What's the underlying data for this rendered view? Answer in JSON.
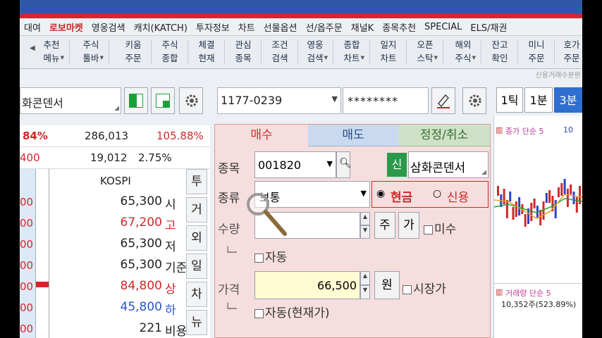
{
  "menu": [
    "대여",
    "로보마켓",
    "영웅검색",
    "캐치(KATCH)",
    "투자정보",
    "차트",
    "선물옵션",
    "선/옵주문",
    "채널K",
    "종목추천",
    "SPECIAL",
    "ELS/채권"
  ],
  "toolbar": [
    {
      "l1": "추천",
      "l2": "메뉴",
      "down": true
    },
    {
      "l1": "주식",
      "l2": "툴바",
      "down": true
    },
    {
      "l1": "키움",
      "l2": "주문",
      "down": false
    },
    {
      "l1": "주식",
      "l2": "종합",
      "down": false
    },
    {
      "l1": "체결",
      "l2": "현재",
      "down": false
    },
    {
      "l1": "관심",
      "l2": "종목",
      "down": false
    },
    {
      "l1": "조건",
      "l2": "검색",
      "down": false
    },
    {
      "l1": "영웅",
      "l2": "검색",
      "down": true
    },
    {
      "l1": "종합",
      "l2": "차트",
      "down": true
    },
    {
      "l1": "일지",
      "l2": "차트",
      "down": false
    },
    {
      "l1": "오픈",
      "l2": "스탁",
      "down": true
    },
    {
      "l1": "해외",
      "l2": "주식",
      "down": true
    },
    {
      "l1": "잔고",
      "l2": "확인",
      "down": false
    },
    {
      "l1": "미니",
      "l2": "주문",
      "down": false
    },
    {
      "l1": "호가",
      "l2": "주문",
      "down": false
    }
  ],
  "status_right": "신용거래수분판",
  "stock_name_box": "화콘덴서",
  "account_number": "1177-0239",
  "password_mask": "********",
  "tick_buttons": [
    "1틱",
    "1분",
    "3분"
  ],
  "left": {
    "rate": "84%",
    "volume": "286,013",
    "pct": "105.88%",
    "left_small": "400",
    "amount": "19,012",
    "amount_pct": "2.75%",
    "index": "KOSPI",
    "price_rows": [
      {
        "side": "00",
        "value": "65,300",
        "label": "시",
        "color": "#222"
      },
      {
        "side": "00",
        "value": "67,200",
        "label": "고",
        "color": "#d0282a"
      },
      {
        "side": "00",
        "value": "65,300",
        "label": "저",
        "color": "#222"
      },
      {
        "side": "00",
        "value": "65,300",
        "label": "기준",
        "color": "#222"
      },
      {
        "side": "00",
        "value": "84,800",
        "label": "상",
        "color": "#d0282a"
      },
      {
        "side": "00",
        "value": "45,800",
        "label": "하",
        "color": "#2a55c8"
      },
      {
        "side": "00",
        "value": "221",
        "label": "비용",
        "color": "#222"
      }
    ],
    "vtabs": [
      "투",
      "거",
      "외",
      "일",
      "차",
      "뉴"
    ]
  },
  "order": {
    "tabs": [
      "매수",
      "매도",
      "정정/취소"
    ],
    "code_label": "종목",
    "code": "001820",
    "credit_badge": "신",
    "stock_name": "삼화콘덴서",
    "kind_label": "종류",
    "kind_value": "보통",
    "cash_label": "현금",
    "credit_label": "신용",
    "qty_label": "수량",
    "qty_btn1": "주",
    "qty_btn2": "가",
    "unfilled_label": "미수",
    "auto_label": "자동",
    "price_label": "가격",
    "price_value": "66,500",
    "won_btn": "원",
    "market_label": "시장가",
    "auto_current_label": "자동(현재가)"
  },
  "chart": {
    "legend_top": "종가 단순 5",
    "legend_top_num": "10",
    "legend_vol": "거래량 단순 5",
    "vol_num": "10,352주(523.89%)"
  },
  "colors": {
    "buy": "#d0282a",
    "sell_tab": "#c9d9ef",
    "modify_tab": "#cfe2c8",
    "order_bg": "#f6dede",
    "field_yellow": "#fffbd2"
  }
}
